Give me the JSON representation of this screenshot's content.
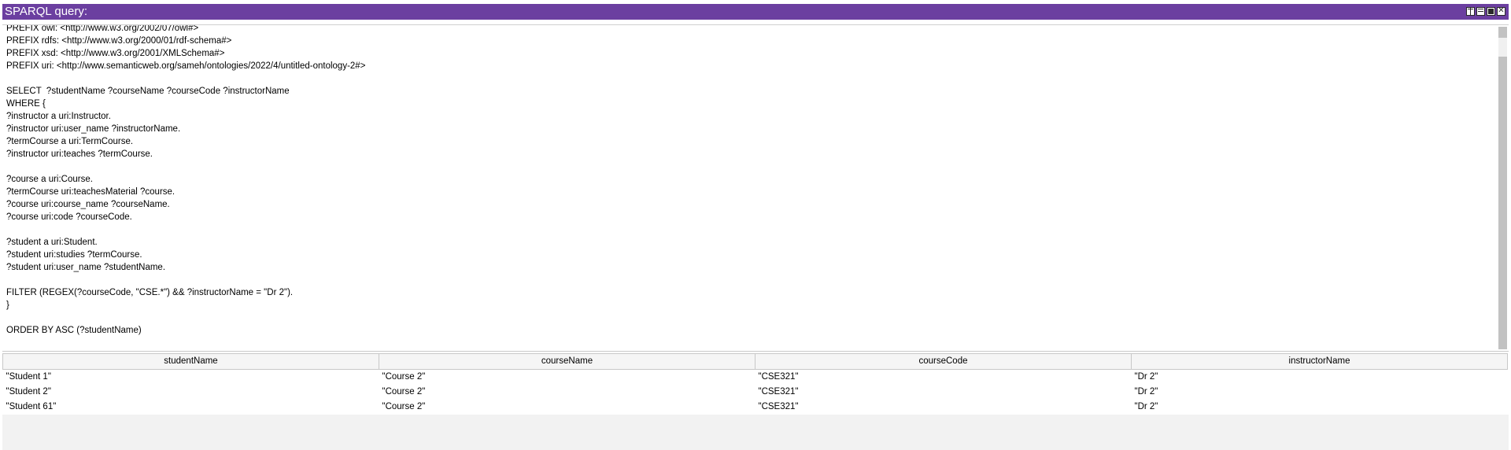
{
  "panel": {
    "title": "SPARQL query:",
    "accent_color": "#6b3fa0",
    "window_buttons": [
      "tile-icon",
      "minimize-icon",
      "maximize-icon",
      "close-icon"
    ]
  },
  "query": {
    "text": "PREFIX owl: <http://www.w3.org/2002/07/owl#>\nPREFIX rdfs: <http://www.w3.org/2000/01/rdf-schema#>\nPREFIX xsd: <http://www.w3.org/2001/XMLSchema#>\nPREFIX uri: <http://www.semanticweb.org/sameh/ontologies/2022/4/untitled-ontology-2#>\n\nSELECT  ?studentName ?courseName ?courseCode ?instructorName\nWHERE {\n?instructor a uri:Instructor.\n?instructor uri:user_name ?instructorName.\n?termCourse a uri:TermCourse.\n?instructor uri:teaches ?termCourse.\n\n?course a uri:Course.\n?termCourse uri:teachesMaterial ?course.\n?course uri:course_name ?courseName.\n?course uri:code ?courseCode.\n\n?student a uri:Student.\n?student uri:studies ?termCourse.\n?student uri:user_name ?studentName.\n\nFILTER (REGEX(?courseCode, \"CSE.*\") && ?instructorName = \"Dr 2\").\n}\n\nORDER BY ASC (?studentName)"
  },
  "results": {
    "columns": [
      "studentName",
      "courseName",
      "courseCode",
      "instructorName"
    ],
    "rows": [
      [
        "\"Student 1\"",
        "\"Course 2\"",
        "\"CSE321\"",
        "\"Dr 2\""
      ],
      [
        "\"Student 2\"",
        "\"Course 2\"",
        "\"CSE321\"",
        "\"Dr 2\""
      ],
      [
        "\"Student 61\"",
        "\"Course 2\"",
        "\"CSE321\"",
        "\"Dr 2\""
      ]
    ]
  }
}
